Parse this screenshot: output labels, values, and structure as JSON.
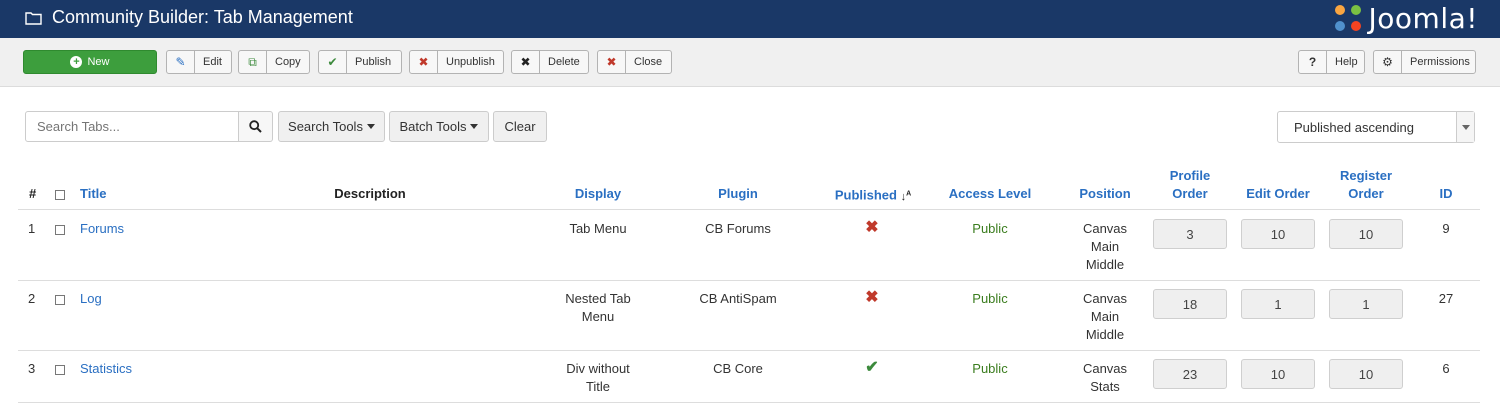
{
  "header": {
    "title": "Community Builder: Tab Management",
    "logo_text": "Joomla!"
  },
  "toolbar": {
    "new": "New",
    "edit": "Edit",
    "copy": "Copy",
    "publish": "Publish",
    "unpublish": "Unpublish",
    "delete": "Delete",
    "close": "Close",
    "help": "Help",
    "permissions": "Permissions"
  },
  "filters": {
    "search_placeholder": "Search Tabs...",
    "search_tools": "Search Tools",
    "batch_tools": "Batch Tools",
    "clear": "Clear",
    "sort_value": "Published ascending"
  },
  "table": {
    "columns": {
      "num": "#",
      "title": "Title",
      "description": "Description",
      "display": "Display",
      "plugin": "Plugin",
      "published": "Published",
      "access": "Access Level",
      "position": "Position",
      "profile_order_1": "Profile",
      "profile_order_2": "Order",
      "edit_order": "Edit Order",
      "register_order_1": "Register",
      "register_order_2": "Order",
      "id": "ID"
    },
    "rows": [
      {
        "num": "1",
        "title": "Forums",
        "display_1": "Tab Menu",
        "display_2": "",
        "plugin": "CB Forums",
        "published": false,
        "access": "Public",
        "pos_1": "Canvas",
        "pos_2": "Main",
        "pos_3": "Middle",
        "profile_order": "3",
        "edit_order": "10",
        "register_order": "10",
        "id": "9"
      },
      {
        "num": "2",
        "title": "Log",
        "display_1": "Nested Tab",
        "display_2": "Menu",
        "plugin": "CB AntiSpam",
        "published": false,
        "access": "Public",
        "pos_1": "Canvas",
        "pos_2": "Main",
        "pos_3": "Middle",
        "profile_order": "18",
        "edit_order": "1",
        "register_order": "1",
        "id": "27"
      },
      {
        "num": "3",
        "title": "Statistics",
        "display_1": "Div without",
        "display_2": "Title",
        "plugin": "CB Core",
        "published": true,
        "access": "Public",
        "pos_1": "Canvas",
        "pos_2": "Stats",
        "pos_3": "",
        "profile_order": "23",
        "edit_order": "10",
        "register_order": "10",
        "id": "6"
      }
    ]
  },
  "colors": {
    "header_bg": "#1a3867",
    "new_button": "#3d9e3d",
    "link": "#2a6fc2",
    "access_green": "#3b7d1f",
    "unpublished_red": "#c0392b"
  },
  "icons": {
    "x_mark": "✖",
    "check_mark": "✔",
    "sort_indicator": "↓A/Z"
  }
}
